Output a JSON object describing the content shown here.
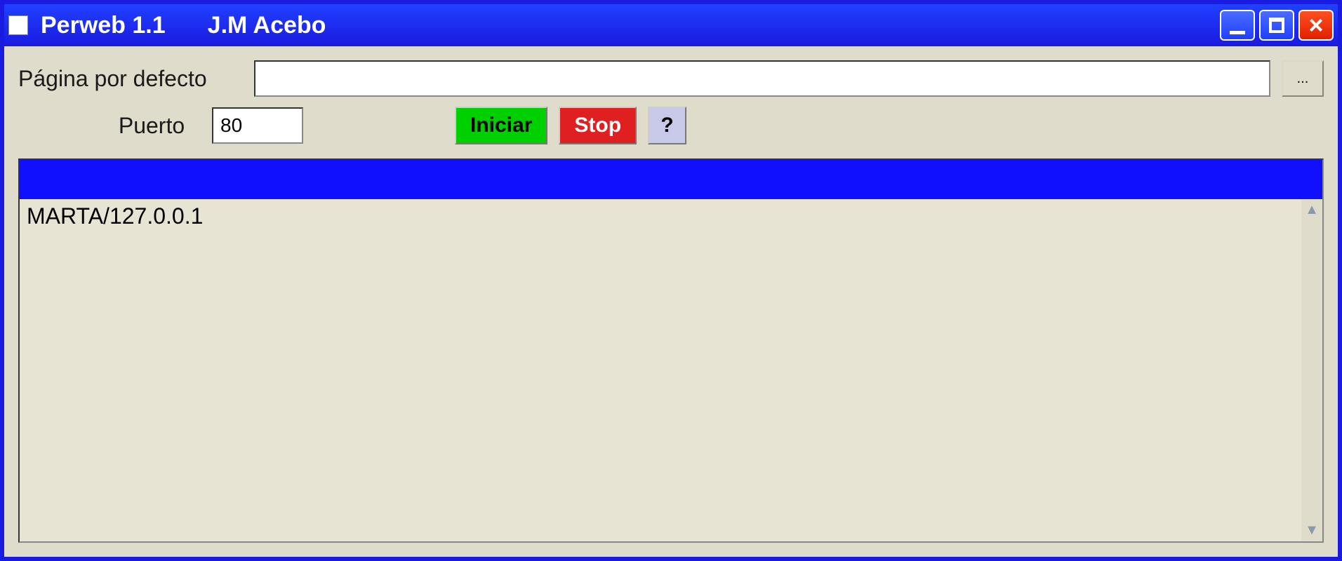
{
  "window": {
    "title_app": "Perweb 1.1",
    "title_author": "J.M Acebo"
  },
  "labels": {
    "default_page": "Página por defecto",
    "puerto": "Puerto"
  },
  "fields": {
    "default_page_value": "",
    "port_value": "80"
  },
  "buttons": {
    "browse": "...",
    "iniciar": "Iniciar",
    "stop": "Stop",
    "help": "?"
  },
  "list": {
    "items": [
      "MARTA/127.0.0.1"
    ]
  }
}
